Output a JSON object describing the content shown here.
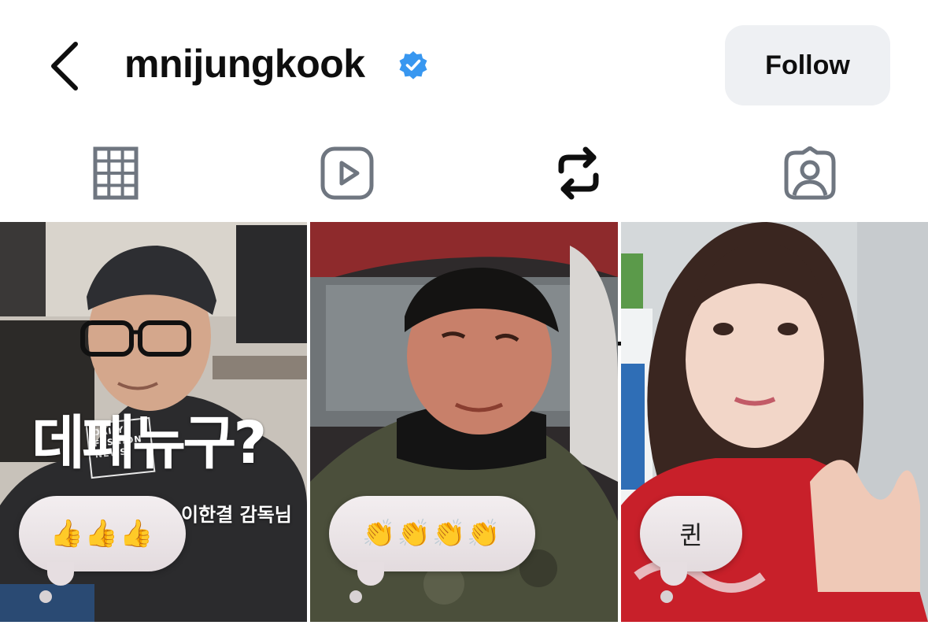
{
  "header": {
    "username": "mnijungkook",
    "verified": true,
    "follow_label": "Follow",
    "back_icon": "chevron-left-icon",
    "verified_icon": "verified-badge-icon",
    "accent_color": "#3897f0"
  },
  "tabs": [
    {
      "id": "posts",
      "icon": "grid-icon",
      "active": false
    },
    {
      "id": "reels",
      "icon": "reels-play-icon",
      "active": false
    },
    {
      "id": "reposts",
      "icon": "repost-icon",
      "active": true
    },
    {
      "id": "tagged",
      "icon": "tagged-person-icon",
      "active": false
    }
  ],
  "grid": {
    "tiles": [
      {
        "caption_big": "데패뉴구?",
        "caption_small": "이한결 감독님",
        "magazine_tag": "DAILY FASHION NEWS",
        "note": "👍👍👍"
      },
      {
        "note": "👏👏👏👏"
      },
      {
        "note": "퀸"
      }
    ]
  }
}
